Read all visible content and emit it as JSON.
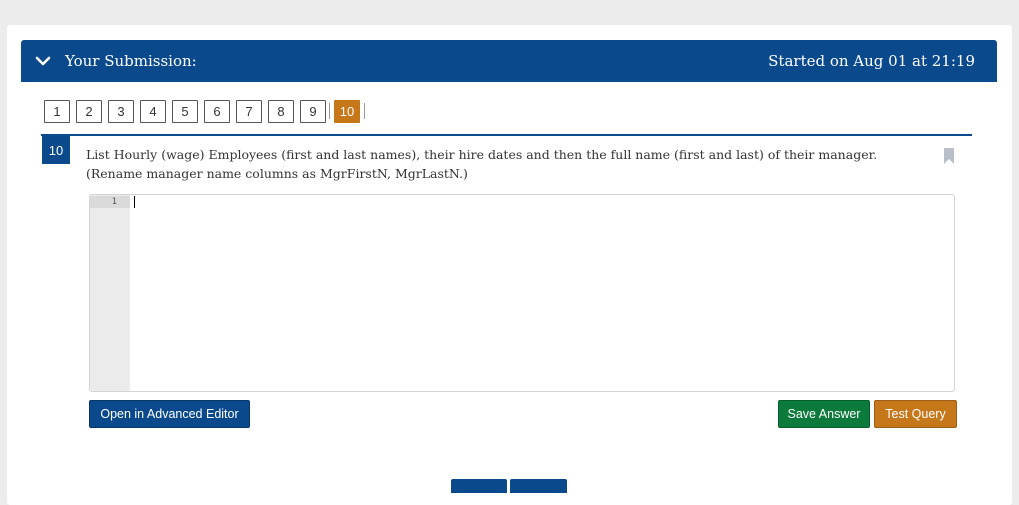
{
  "header": {
    "title": "Your Submission:",
    "started": "Started on Aug 01 at 21:19"
  },
  "pager": {
    "pages": [
      "1",
      "2",
      "3",
      "4",
      "5",
      "6",
      "7",
      "8",
      "9"
    ],
    "current": "10"
  },
  "question": {
    "number": "10",
    "text": "List Hourly (wage) Employees (first and last names), their hire dates and then the full name (first and last) of their manager. (Rename manager name columns as MgrFirstN, MgrLastN.)"
  },
  "editor": {
    "line_number": "1",
    "content": ""
  },
  "buttons": {
    "advanced_editor": "Open in Advanced Editor",
    "save_answer": "Save Answer",
    "test_query": "Test Query"
  },
  "colors": {
    "primary": "#0a4a8c",
    "accent_orange": "#c5771a",
    "success_green": "#0b7a3b"
  }
}
